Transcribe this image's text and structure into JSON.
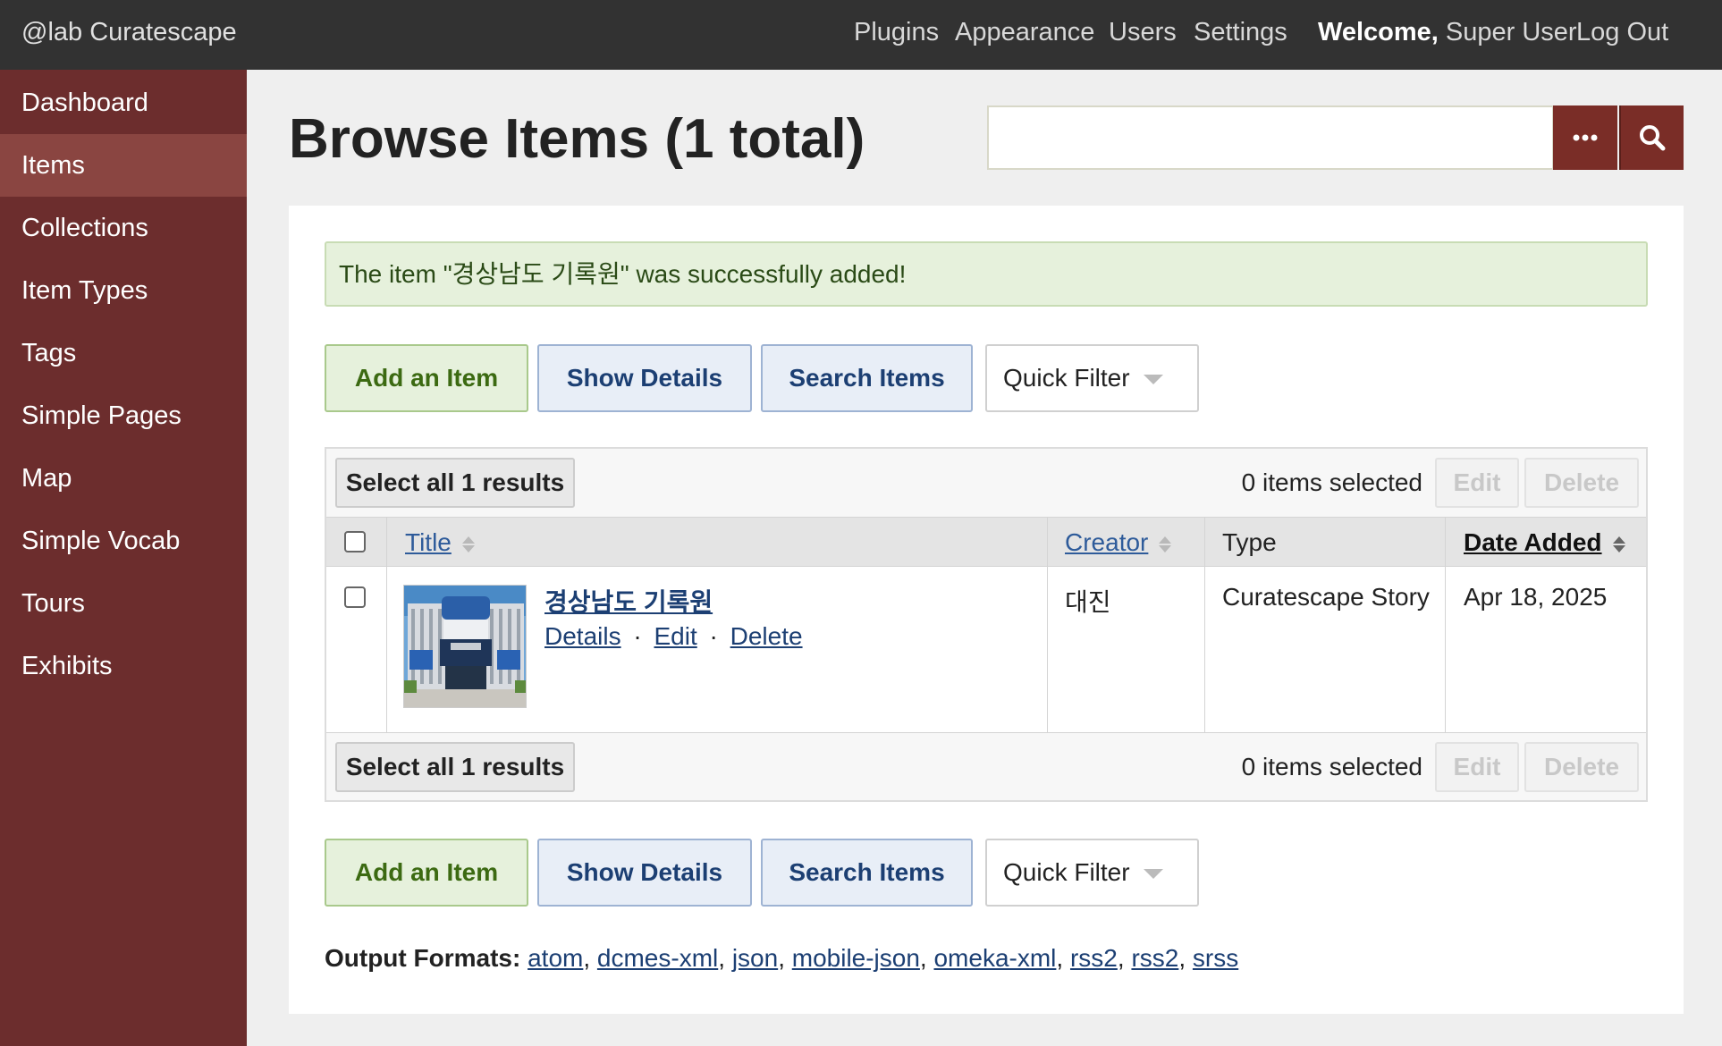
{
  "topbar": {
    "site_name": "@lab Curatescape",
    "nav": [
      "Plugins",
      "Appearance",
      "Users",
      "Settings"
    ],
    "welcome_label": "Welcome,",
    "user_name": "Super User",
    "logout": "Log Out"
  },
  "sidebar": {
    "items": [
      {
        "label": "Dashboard"
      },
      {
        "label": "Items",
        "active": true
      },
      {
        "label": "Collections"
      },
      {
        "label": "Item Types"
      },
      {
        "label": "Tags"
      },
      {
        "label": "Simple Pages"
      },
      {
        "label": "Map"
      },
      {
        "label": "Simple Vocab"
      },
      {
        "label": "Tours"
      },
      {
        "label": "Exhibits"
      }
    ]
  },
  "header": {
    "title": "Browse Items (1 total)",
    "search_value": ""
  },
  "flash": {
    "message": "The item \"경상남도 기록원\" was successfully added!"
  },
  "actions": {
    "add_item": "Add an Item",
    "show_details": "Show Details",
    "search_items": "Search Items",
    "quick_filter": "Quick Filter"
  },
  "batch": {
    "select_all": "Select all 1 results",
    "selected_count": "0 items selected",
    "edit": "Edit",
    "delete": "Delete"
  },
  "table": {
    "columns": {
      "title": "Title",
      "creator": "Creator",
      "type": "Type",
      "date_added": "Date Added"
    },
    "rows": [
      {
        "title": "경상남도 기록원",
        "details": "Details",
        "edit": "Edit",
        "delete": "Delete",
        "separator": "·",
        "creator": "대진",
        "type": "Curatescape Story",
        "date_added": "Apr 18, 2025"
      }
    ]
  },
  "output_formats": {
    "label": "Output Formats:",
    "formats": [
      "atom",
      "dcmes-xml",
      "json",
      "mobile-json",
      "omeka-xml",
      "rss2",
      "rss2",
      "srss"
    ]
  }
}
